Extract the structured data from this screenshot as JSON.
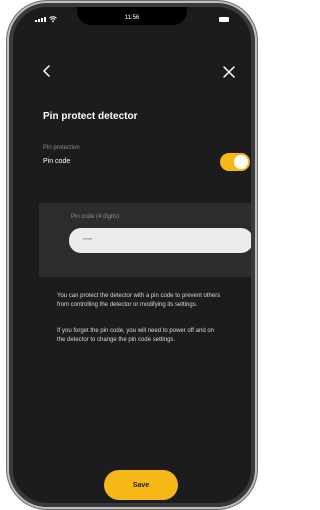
{
  "status_bar": {
    "time": "11:56"
  },
  "nav": {
    "back_icon": "chevron-left-icon",
    "close_icon": "close-icon"
  },
  "page": {
    "title": "Pin protect detector"
  },
  "settings": {
    "section_label": "Pin protection",
    "pin_code_label": "Pin code",
    "pin_code_enabled": true
  },
  "pin_panel": {
    "label": "Pin code (4 digits)",
    "placeholder": "****"
  },
  "info": {
    "paragraph1": "You can protect the detector with a pin code to prevent others from controlling the detector or modifying its settings.",
    "paragraph2": "If you forget the pin code, you will need to power off and on the detector to change the pin code settings."
  },
  "actions": {
    "save_label": "Save"
  },
  "colors": {
    "accent": "#f6b816",
    "background": "#1c1c1e",
    "panel": "#2c2c2e"
  }
}
